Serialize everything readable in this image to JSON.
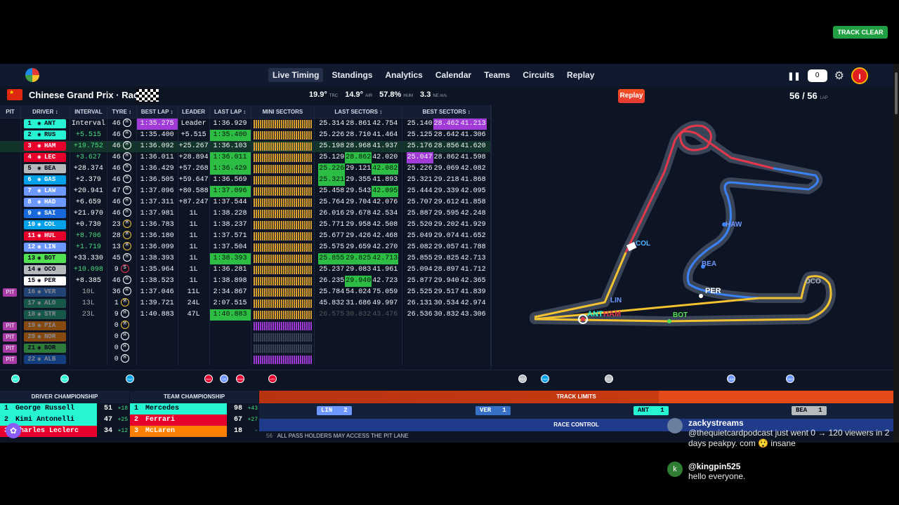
{
  "nav": {
    "links": [
      "Live Timing",
      "Standings",
      "Analytics",
      "Calendar",
      "Teams",
      "Circuits",
      "Replay"
    ],
    "counter": "0",
    "avatar": "I"
  },
  "race": {
    "title": "Chinese Grand Prix · Race",
    "flag": "★",
    "weather": [
      {
        "v": "19.9°",
        "u": "TRC"
      },
      {
        "v": "14.9°",
        "u": "AIR"
      },
      {
        "v": "57.8%",
        "u": "HUM"
      },
      {
        "v": "3.3",
        "u": "NE m/s"
      }
    ],
    "replay": "Replay",
    "lap": "56 / 56",
    "lap_unit": "LAP",
    "status": "TRACK CLEAR"
  },
  "headers": [
    "PIT",
    "DRIVER ↕",
    "INTERVAL",
    "TYRE ↕",
    "BEST LAP ↕",
    "LEADER",
    "LAST LAP ↕",
    "MINI SECTORS",
    "LAST SECTORS ↕",
    "BEST SECTORS ↕"
  ],
  "rows": [
    {
      "pit": "",
      "pos": "1",
      "code": "ANT",
      "color": "#27f4d2",
      "int": "Interval",
      "intc": "#fff",
      "laps": "46",
      "tyre": "H",
      "best": "1:35.275",
      "bestc": "purple",
      "lead": "Leader",
      "last": "1:36.929",
      "lastc": "",
      "ls": [
        "25.314",
        "28.861",
        "42.754"
      ],
      "lsc": [
        "",
        "",
        ""
      ],
      "bs": [
        "25.140",
        "28.462",
        "41.213"
      ],
      "bsc": [
        "",
        "purple",
        "purple"
      ]
    },
    {
      "pit": "",
      "pos": "2",
      "code": "RUS",
      "color": "#27f4d2",
      "int": "+5.515",
      "intc": "#4ade80",
      "laps": "46",
      "tyre": "H",
      "best": "1:35.400",
      "bestc": "",
      "lead": "+5.515",
      "last": "1:35.400",
      "lastc": "green",
      "ls": [
        "25.226",
        "28.710",
        "41.464"
      ],
      "lsc": [
        "",
        "",
        ""
      ],
      "bs": [
        "25.125",
        "28.642",
        "41.306"
      ],
      "bsc": [
        "",
        "",
        ""
      ]
    },
    {
      "pit": "",
      "pos": "3",
      "code": "HAM",
      "color": "#e8002d",
      "int": "+19.752",
      "intc": "#4ade80",
      "laps": "46",
      "tyre": "H",
      "best": "1:36.092",
      "bestc": "",
      "lead": "+25.267",
      "last": "1:36.103",
      "lastc": "",
      "ls": [
        "25.198",
        "28.968",
        "41.937"
      ],
      "lsc": [
        "",
        "",
        ""
      ],
      "bs": [
        "25.176",
        "28.856",
        "41.620"
      ],
      "bsc": [
        "",
        "",
        ""
      ],
      "hl": true
    },
    {
      "pit": "",
      "pos": "4",
      "code": "LEC",
      "color": "#e8002d",
      "int": "+3.627",
      "intc": "#4ade80",
      "laps": "46",
      "tyre": "H",
      "best": "1:36.011",
      "bestc": "",
      "lead": "+28.894",
      "last": "1:36.011",
      "lastc": "green",
      "ls": [
        "25.129",
        "28.862",
        "42.020"
      ],
      "lsc": [
        "",
        "green",
        ""
      ],
      "bs": [
        "25.047",
        "28.862",
        "41.598"
      ],
      "bsc": [
        "purple",
        "",
        ""
      ]
    },
    {
      "pit": "",
      "pos": "5",
      "code": "BEA",
      "color": "#b6babd",
      "int": "+28.374",
      "intc": "#fff",
      "laps": "46",
      "tyre": "H",
      "best": "1:36.429",
      "bestc": "",
      "lead": "+57.268",
      "last": "1:36.429",
      "lastc": "green",
      "ls": [
        "25.226",
        "29.121",
        "42.082"
      ],
      "lsc": [
        "green",
        "",
        "green"
      ],
      "bs": [
        "25.226",
        "29.069",
        "42.082"
      ],
      "bsc": [
        "",
        "",
        ""
      ]
    },
    {
      "pit": "",
      "pos": "6",
      "code": "GAS",
      "color": "#00a1e8",
      "int": "+2.379",
      "intc": "#fff",
      "laps": "46",
      "tyre": "H",
      "best": "1:36.505",
      "bestc": "",
      "lead": "+59.647",
      "last": "1:36.569",
      "lastc": "",
      "ls": [
        "25.321",
        "29.355",
        "41.893"
      ],
      "lsc": [
        "green",
        "",
        ""
      ],
      "bs": [
        "25.321",
        "29.218",
        "41.868"
      ],
      "bsc": [
        "",
        "",
        ""
      ]
    },
    {
      "pit": "",
      "pos": "7",
      "code": "LAW",
      "color": "#6c98ff",
      "int": "+20.941",
      "intc": "#fff",
      "laps": "47",
      "tyre": "H",
      "best": "1:37.096",
      "bestc": "",
      "lead": "+80.588",
      "last": "1:37.096",
      "lastc": "green",
      "ls": [
        "25.458",
        "29.543",
        "42.095"
      ],
      "lsc": [
        "",
        "",
        "green"
      ],
      "bs": [
        "25.444",
        "29.339",
        "42.095"
      ],
      "bsc": [
        "",
        "",
        ""
      ]
    },
    {
      "pit": "",
      "pos": "8",
      "code": "HAD",
      "color": "#6c98ff",
      "int": "+6.659",
      "intc": "#fff",
      "laps": "46",
      "tyre": "H",
      "best": "1:37.311",
      "bestc": "",
      "lead": "+87.247",
      "last": "1:37.544",
      "lastc": "",
      "ls": [
        "25.764",
        "29.704",
        "42.076"
      ],
      "lsc": [
        "",
        "",
        ""
      ],
      "bs": [
        "25.707",
        "29.612",
        "41.858"
      ],
      "bsc": [
        "",
        "",
        ""
      ]
    },
    {
      "pit": "",
      "pos": "9",
      "code": "SAI",
      "color": "#1868db",
      "int": "+21.970",
      "intc": "#fff",
      "laps": "46",
      "tyre": "H",
      "best": "1:37.981",
      "bestc": "",
      "lead": "1L",
      "last": "1:38.228",
      "lastc": "",
      "ls": [
        "26.016",
        "29.678",
        "42.534"
      ],
      "lsc": [
        "",
        "",
        ""
      ],
      "bs": [
        "25.887",
        "29.595",
        "42.248"
      ],
      "bsc": [
        "",
        "",
        ""
      ]
    },
    {
      "pit": "",
      "pos": "10",
      "code": "COL",
      "color": "#00a1e8",
      "int": "+0.730",
      "intc": "#fff",
      "laps": "23",
      "tyre": "M",
      "best": "1:36.783",
      "bestc": "",
      "lead": "1L",
      "last": "1:38.237",
      "lastc": "",
      "ls": [
        "25.771",
        "29.958",
        "42.508"
      ],
      "lsc": [
        "",
        "",
        ""
      ],
      "bs": [
        "25.520",
        "29.202",
        "41.929"
      ],
      "bsc": [
        "",
        "",
        ""
      ]
    },
    {
      "pit": "",
      "pos": "11",
      "code": "HUL",
      "color": "#e8002d",
      "int": "+8.706",
      "intc": "#4ade80",
      "laps": "28",
      "tyre": "M",
      "best": "1:36.180",
      "bestc": "",
      "lead": "1L",
      "last": "1:37.571",
      "lastc": "",
      "ls": [
        "25.677",
        "29.426",
        "42.468"
      ],
      "lsc": [
        "",
        "",
        ""
      ],
      "bs": [
        "25.049",
        "29.074",
        "41.652"
      ],
      "bsc": [
        "",
        "",
        ""
      ]
    },
    {
      "pit": "",
      "pos": "12",
      "code": "LIN",
      "color": "#6c98ff",
      "int": "+1.719",
      "intc": "#4ade80",
      "laps": "13",
      "tyre": "M",
      "best": "1:36.099",
      "bestc": "",
      "lead": "1L",
      "last": "1:37.504",
      "lastc": "",
      "ls": [
        "25.575",
        "29.659",
        "42.270"
      ],
      "lsc": [
        "",
        "",
        ""
      ],
      "bs": [
        "25.082",
        "29.057",
        "41.788"
      ],
      "bsc": [
        "",
        "",
        ""
      ]
    },
    {
      "pit": "",
      "pos": "13",
      "code": "BOT",
      "color": "#52e252",
      "int": "+33.330",
      "intc": "#fff",
      "laps": "45",
      "tyre": "H",
      "best": "1:38.393",
      "bestc": "",
      "lead": "1L",
      "last": "1:38.393",
      "lastc": "green",
      "ls": [
        "25.855",
        "29.825",
        "42.713"
      ],
      "lsc": [
        "green",
        "green",
        "green"
      ],
      "bs": [
        "25.855",
        "29.825",
        "42.713"
      ],
      "bsc": [
        "",
        "",
        ""
      ]
    },
    {
      "pit": "",
      "pos": "14",
      "code": "OCO",
      "color": "#b6babd",
      "int": "+10.098",
      "intc": "#4ade80",
      "laps": "9",
      "tyre": "S",
      "best": "1:35.964",
      "bestc": "",
      "lead": "1L",
      "last": "1:36.281",
      "lastc": "",
      "ls": [
        "25.237",
        "29.083",
        "41.961"
      ],
      "lsc": [
        "",
        "",
        ""
      ],
      "bs": [
        "25.094",
        "28.897",
        "41.712"
      ],
      "bsc": [
        "",
        "",
        ""
      ]
    },
    {
      "pit": "",
      "pos": "15",
      "code": "PER",
      "color": "#fff",
      "int": "+8.385",
      "intc": "#fff",
      "laps": "46",
      "tyre": "H",
      "best": "1:38.523",
      "bestc": "",
      "lead": "1L",
      "last": "1:38.898",
      "lastc": "",
      "ls": [
        "26.235",
        "29.940",
        "42.723"
      ],
      "lsc": [
        "",
        "green",
        ""
      ],
      "bs": [
        "25.877",
        "29.940",
        "42.365"
      ],
      "bsc": [
        "",
        "",
        ""
      ]
    },
    {
      "pit": "PIT",
      "pos": "16",
      "code": "VER",
      "color": "#3671c6",
      "int": "10L",
      "intc": "#aaa",
      "laps": "36",
      "tyre": "H",
      "best": "1:37.046",
      "bestc": "",
      "lead": "11L",
      "last": "2:34.867",
      "lastc": "",
      "ls": [
        "25.784",
        "54.024",
        "75.059"
      ],
      "lsc": [
        "",
        "",
        ""
      ],
      "bs": [
        "25.525",
        "29.517",
        "41.839"
      ],
      "bsc": [
        "",
        "",
        ""
      ],
      "dim": true
    },
    {
      "pit": "",
      "pos": "17",
      "code": "ALO",
      "color": "#229971",
      "int": "13L",
      "intc": "#aaa",
      "laps": "1",
      "tyre": "M",
      "best": "1:39.721",
      "bestc": "",
      "lead": "24L",
      "last": "2:07.515",
      "lastc": "",
      "ls": [
        "45.832",
        "31.686",
        "49.997"
      ],
      "lsc": [
        "",
        "",
        ""
      ],
      "bs": [
        "26.131",
        "30.534",
        "42.974"
      ],
      "bsc": [
        "",
        "",
        ""
      ],
      "dim": true
    },
    {
      "pit": "",
      "pos": "18",
      "code": "STR",
      "color": "#229971",
      "int": "23L",
      "intc": "#aaa",
      "laps": "9",
      "tyre": "H",
      "best": "1:40.883",
      "bestc": "",
      "lead": "47L",
      "last": "1:40.883",
      "lastc": "green",
      "ls": [
        "26.575",
        "30.832",
        "43.476"
      ],
      "lsc": [
        "dim",
        "dim",
        "dim"
      ],
      "bs": [
        "26.536",
        "30.832",
        "43.306"
      ],
      "bsc": [
        "",
        "",
        ""
      ],
      "dim": true
    },
    {
      "pit": "PIT",
      "pos": "19",
      "code": "PIA",
      "color": "#ff8000",
      "int": "",
      "intc": "#555",
      "laps": "0",
      "tyre": "M",
      "best": "",
      "bestc": "",
      "lead": "",
      "last": "",
      "lastc": "",
      "ls": [
        "",
        "",
        ""
      ],
      "lsc": [
        "",
        "",
        ""
      ],
      "bs": [
        "",
        "",
        ""
      ],
      "bsc": [
        "",
        "",
        ""
      ],
      "dim": true
    },
    {
      "pit": "PIT",
      "pos": "20",
      "code": "NOR",
      "color": "#ff8000",
      "int": "",
      "intc": "#555",
      "laps": "0",
      "tyre": "H",
      "best": "",
      "bestc": "",
      "lead": "",
      "last": "",
      "lastc": "",
      "ls": [
        "",
        "",
        ""
      ],
      "lsc": [
        "",
        "",
        ""
      ],
      "bs": [
        "",
        "",
        ""
      ],
      "bsc": [
        "",
        "",
        ""
      ],
      "dim": true
    },
    {
      "pit": "PIT",
      "pos": "21",
      "code": "BOR",
      "color": "#52e252",
      "int": "",
      "intc": "#555",
      "laps": "0",
      "tyre": "H",
      "best": "",
      "bestc": "",
      "lead": "",
      "last": "",
      "lastc": "",
      "ls": [
        "",
        "",
        ""
      ],
      "lsc": [
        "",
        "",
        ""
      ],
      "bs": [
        "",
        "",
        ""
      ],
      "bsc": [
        "",
        "",
        ""
      ],
      "dim": true
    },
    {
      "pit": "PIT",
      "pos": "22",
      "code": "ALB",
      "color": "#1868db",
      "int": "",
      "intc": "#555",
      "laps": "0",
      "tyre": "H",
      "best": "",
      "bestc": "",
      "lead": "",
      "last": "",
      "lastc": "",
      "ls": [
        "",
        "",
        ""
      ],
      "lsc": [
        "",
        "",
        ""
      ],
      "bs": [
        "",
        "",
        ""
      ],
      "bsc": [
        "",
        "",
        ""
      ],
      "dim": true
    }
  ],
  "map_labels": [
    "COL",
    "HAW",
    "BEA",
    "PER",
    "OCO",
    "BOT",
    "LIN",
    "ANT",
    "HAM"
  ],
  "strip": [
    {
      "code": "ANT",
      "c": "#27f4d2"
    },
    {
      "code": "RUS",
      "c": "#27f4d2"
    },
    {
      "code": "GAS",
      "c": "#00a1e8"
    },
    {
      "code": "HUL",
      "c": "#e8002d"
    },
    {
      "code": "LIN",
      "c": "#6c98ff"
    },
    {
      "code": "HAM",
      "c": "#e8002d"
    },
    {
      "code": "LEC",
      "c": "#e8002d"
    },
    {
      "code": "BEA",
      "c": "#b6babd"
    },
    {
      "code": "GAS",
      "c": "#00a1e8"
    },
    {
      "code": "OCO",
      "c": "#b6babd"
    },
    {
      "code": "LAW",
      "c": "#6c98ff"
    },
    {
      "code": "HAD",
      "c": "#6c98ff"
    }
  ],
  "driver_champ": {
    "title": "DRIVER CHAMPIONSHIP",
    "rows": [
      {
        "pos": "1",
        "name": "George Russell",
        "pts": "51",
        "delta": "+18",
        "c": "#27f4d2"
      },
      {
        "pos": "2",
        "name": "Kimi Antonelli",
        "pts": "47",
        "delta": "+25",
        "c": "#27f4d2"
      },
      {
        "pos": "3",
        "name": "Charles Leclerc",
        "pts": "34",
        "delta": "+12",
        "c": "#e8002d"
      }
    ]
  },
  "team_champ": {
    "title": "TEAM CHAMPIONSHIP",
    "rows": [
      {
        "pos": "1",
        "name": "Mercedes",
        "pts": "98",
        "delta": "+43",
        "c": "#27f4d2"
      },
      {
        "pos": "2",
        "name": "Ferrari",
        "pts": "67",
        "delta": "+27",
        "c": "#e8002d"
      },
      {
        "pos": "3",
        "name": "McLaren",
        "pts": "18",
        "delta": "-",
        "c": "#ff8000"
      }
    ]
  },
  "track_limits": {
    "title": "TRACK LIMITS",
    "chips": [
      {
        "code": "LIN",
        "n": "2",
        "c": "#6c98ff"
      },
      {
        "code": "VER",
        "n": "1",
        "c": "#3671c6"
      },
      {
        "code": "ANT",
        "n": "1",
        "c": "#27f4d2"
      },
      {
        "code": "BEA",
        "n": "1",
        "c": "#b6babd"
      }
    ]
  },
  "race_control": {
    "title": "RACE CONTROL",
    "lap": "56",
    "message": "ALL PASS HOLDERS MAY ACCESS THE PIT LANE"
  },
  "chat": [
    {
      "name": "zackystreams",
      "text": "@thequietcardpodcast just went 0 → 120 viewers in 2 days peakpy. com 😲 insane"
    },
    {
      "name": "@kingpin525",
      "text": "hello everyone."
    }
  ]
}
